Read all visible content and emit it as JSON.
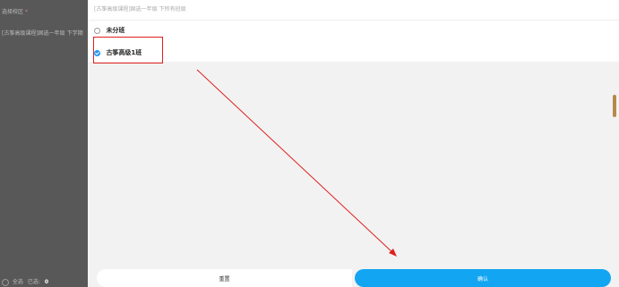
{
  "left_page": {
    "field_label": "选择校区",
    "required_mark": "*",
    "field_value": "[古筝高级课程]固选一年级 下学期",
    "bottom_label": "全选",
    "selected_label": "已选:",
    "selected_count": "0"
  },
  "panel": {
    "header_text": "[古筝高级课程]固选一年级 下所有班级",
    "options": [
      {
        "label": "未分班",
        "checked": false
      },
      {
        "label": "古筝高级1班",
        "checked": true
      }
    ]
  },
  "footer": {
    "reset_label": "重置",
    "confirm_label": "确认"
  },
  "colors": {
    "accent": "#12a5f2",
    "annotation": "#e02020"
  }
}
